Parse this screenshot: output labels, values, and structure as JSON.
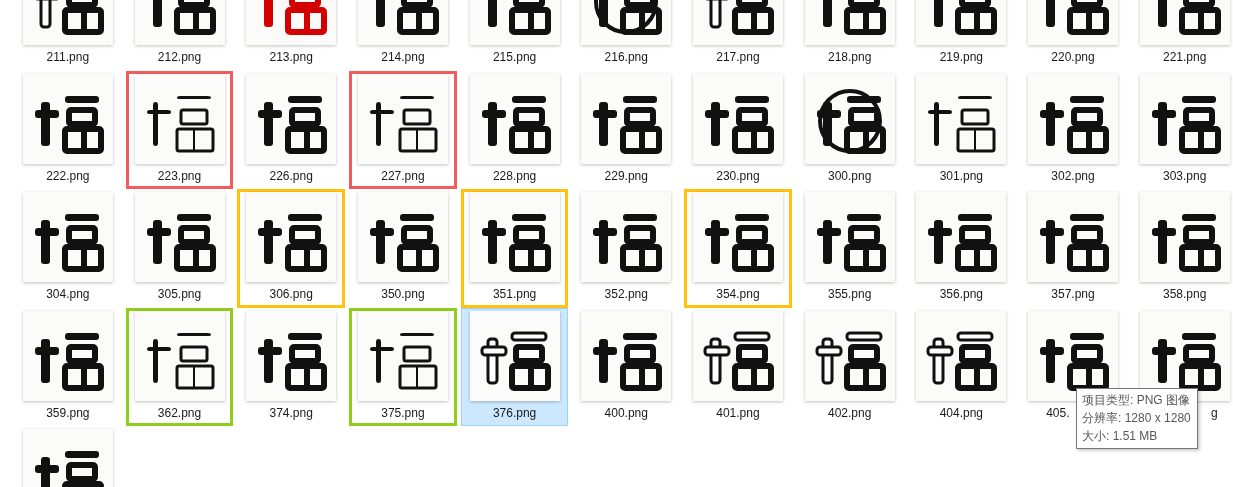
{
  "items": [
    {
      "label": "211.png",
      "selected": false
    },
    {
      "label": "212.png",
      "selected": false
    },
    {
      "label": "213.png",
      "selected": false
    },
    {
      "label": "214.png",
      "selected": false
    },
    {
      "label": "215.png",
      "selected": false
    },
    {
      "label": "216.png",
      "selected": false
    },
    {
      "label": "217.png",
      "selected": false
    },
    {
      "label": "218.png",
      "selected": false
    },
    {
      "label": "219.png",
      "selected": false
    },
    {
      "label": "220.png",
      "selected": false
    },
    {
      "label": "221.png",
      "selected": false
    },
    {
      "label": "222.png",
      "selected": false
    },
    {
      "label": "223.png",
      "selected": false,
      "color": "#f25c5c"
    },
    {
      "label": "226.png",
      "selected": false
    },
    {
      "label": "227.png",
      "selected": false,
      "color": "#f25c5c"
    },
    {
      "label": "228.png",
      "selected": false
    },
    {
      "label": "229.png",
      "selected": false
    },
    {
      "label": "230.png",
      "selected": false
    },
    {
      "label": "300.png",
      "selected": false
    },
    {
      "label": "301.png",
      "selected": false
    },
    {
      "label": "302.png",
      "selected": false
    },
    {
      "label": "303.png",
      "selected": false
    },
    {
      "label": "304.png",
      "selected": false
    },
    {
      "label": "305.png",
      "selected": false
    },
    {
      "label": "306.png",
      "selected": false,
      "color": "#ffc20e"
    },
    {
      "label": "350.png",
      "selected": false
    },
    {
      "label": "351.png",
      "selected": false,
      "color": "#ffc20e"
    },
    {
      "label": "352.png",
      "selected": false
    },
    {
      "label": "354.png",
      "selected": false,
      "color": "#ffc20e"
    },
    {
      "label": "355.png",
      "selected": false
    },
    {
      "label": "356.png",
      "selected": false
    },
    {
      "label": "357.png",
      "selected": false
    },
    {
      "label": "358.png",
      "selected": false
    },
    {
      "label": "359.png",
      "selected": false
    },
    {
      "label": "362.png",
      "selected": false,
      "color": "#8fce1a"
    },
    {
      "label": "374.png",
      "selected": false
    },
    {
      "label": "375.png",
      "selected": false,
      "color": "#8fce1a"
    },
    {
      "label": "376.png",
      "selected": true
    },
    {
      "label": "400.png",
      "selected": false
    },
    {
      "label": "401.png",
      "selected": false
    },
    {
      "label": "402.png",
      "selected": false
    },
    {
      "label": "404.png",
      "selected": false
    },
    {
      "label": "405.",
      "selected": false,
      "cut_end": true
    },
    {
      "label": "g",
      "selected": false,
      "cut_start": true
    },
    {
      "selected": false
    }
  ],
  "tooltip": {
    "lines": [
      "项目类型: PNG 图像",
      "分辨率: 1280 x 1280",
      "大小: 1.51 MB"
    ]
  }
}
